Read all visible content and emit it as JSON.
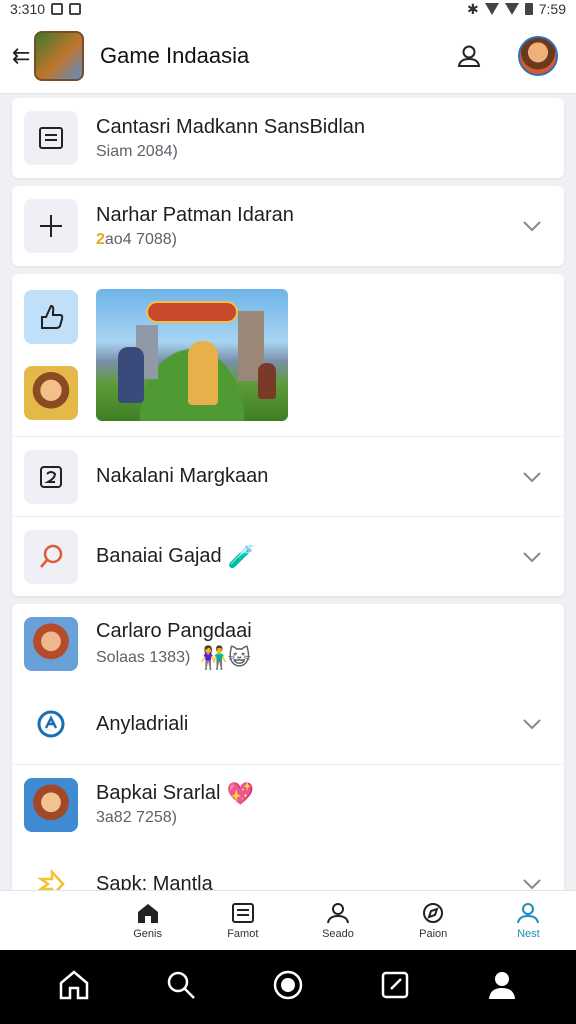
{
  "status_bar": {
    "time_left": "3:310",
    "time_right": "7:59"
  },
  "app_bar": {
    "title": "Game Indaasia"
  },
  "items": [
    {
      "primary": "Cantasri Madkann SansBidlan",
      "secondary": "Siam 2084)"
    },
    {
      "primary": "Narhar Patman Idaran",
      "secondary_highlight": "2",
      "secondary_rest": "ao4 7088)"
    },
    {
      "primary": "Nakalani Margkaan"
    },
    {
      "primary": "Banaiai Gajad"
    },
    {
      "primary": "Carlaro Pangdaai",
      "secondary": "Solaas 1383)"
    },
    {
      "primary": "Anyladriali"
    },
    {
      "primary": "Bapkai Srarlal",
      "secondary": "3a82 7258)"
    },
    {
      "primary": "Sapk: Mantla"
    }
  ],
  "bottom_nav": [
    {
      "label": "Genis",
      "icon": "home-icon"
    },
    {
      "label": "Famot",
      "icon": "list-icon"
    },
    {
      "label": "Seado",
      "icon": "person-icon"
    },
    {
      "label": "Paion",
      "icon": "compass-icon"
    },
    {
      "label": "Nest",
      "icon": "profile-icon",
      "active": true
    }
  ],
  "colors": {
    "accent": "#1a8fb3",
    "highlight": "#e6a81c",
    "icon_blue": "#1a6fb3",
    "icon_red": "#e05a3a",
    "icon_yellow": "#f2c230"
  }
}
